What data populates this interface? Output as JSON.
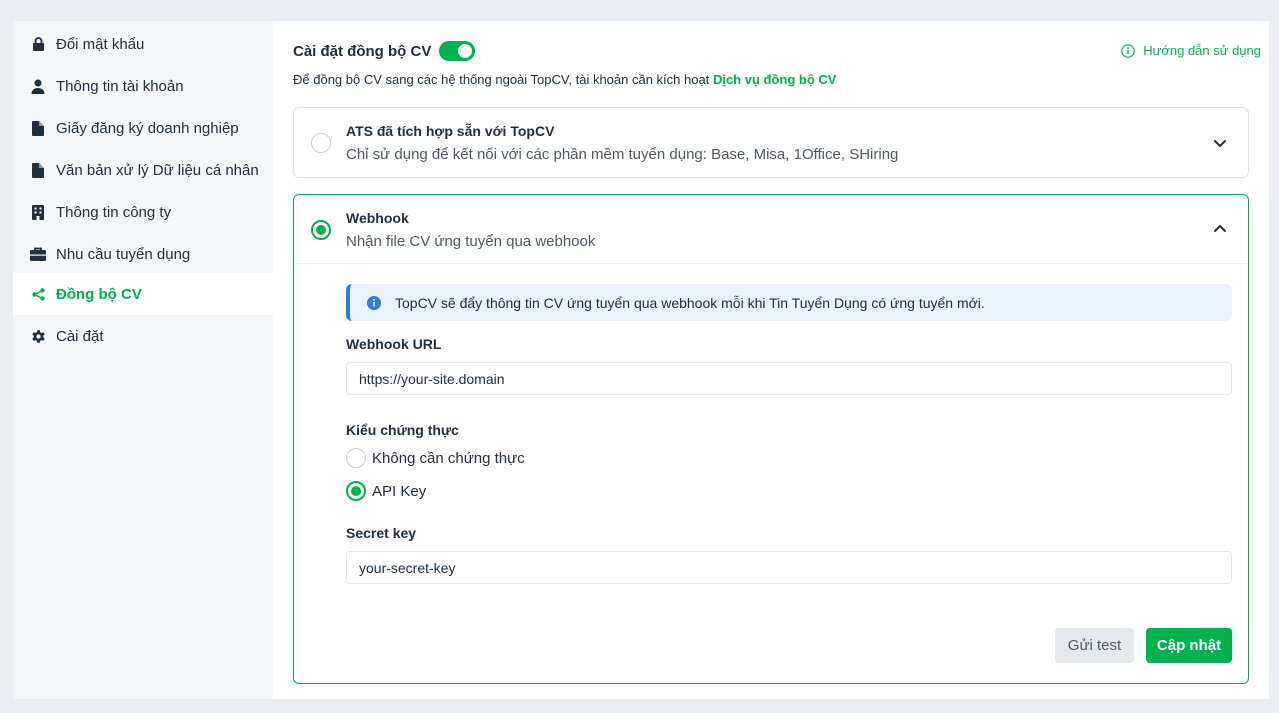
{
  "sidebar": {
    "items": [
      {
        "label": "Đổi mật khẩu",
        "icon": "lock-icon"
      },
      {
        "label": "Thông tin tài khoản",
        "icon": "user-icon"
      },
      {
        "label": "Giấy đăng ký doanh nghiệp",
        "icon": "file-icon"
      },
      {
        "label": "Văn bản xử lý Dữ liệu cá nhân",
        "icon": "file-icon"
      },
      {
        "label": "Thông tin công ty",
        "icon": "building-icon"
      },
      {
        "label": "Nhu cầu tuyển dụng",
        "icon": "briefcase-icon"
      },
      {
        "label": "Đồng bộ CV",
        "icon": "share-icon",
        "active": true
      },
      {
        "label": "Cài đặt",
        "icon": "gear-icon"
      }
    ]
  },
  "header": {
    "title": "Cài đặt đồng bộ CV",
    "toggle_on": true,
    "guide_label": "Hướng dẫn sử dụng",
    "description": "Để đồng bộ CV sang các hệ thống ngoài TopCV, tài khoản cần kích hoạt",
    "description_link": "Dịch vụ đồng bộ CV"
  },
  "ats": {
    "title": "ATS đã tích hợp sẵn với TopCV",
    "subtitle": "Chỉ sử dụng để kết nối với các phần mềm tuyển dụng: Base, Misa, 1Office, SHiring"
  },
  "webhook": {
    "title": "Webhook",
    "subtitle": "Nhận file CV ứng tuyển qua webhook",
    "alert": "TopCV sẽ đẩy thông tin CV ứng tuyển qua webhook mỗi khi Tin Tuyển Dụng có ứng tuyển mới.",
    "url_label": "Webhook URL",
    "url_value": "https://your-site.domain",
    "auth_label": "Kiểu chứng thực",
    "auth_options": [
      "Không cần chứng thực",
      "API Key"
    ],
    "auth_selected": "API Key",
    "secret_label": "Secret key",
    "secret_value": "your-secret-key",
    "test_button": "Gửi test",
    "save_button": "Cập nhật"
  },
  "colors": {
    "accent": "#00b14f",
    "info": "#2f7be6",
    "background": "#e9edf2"
  }
}
